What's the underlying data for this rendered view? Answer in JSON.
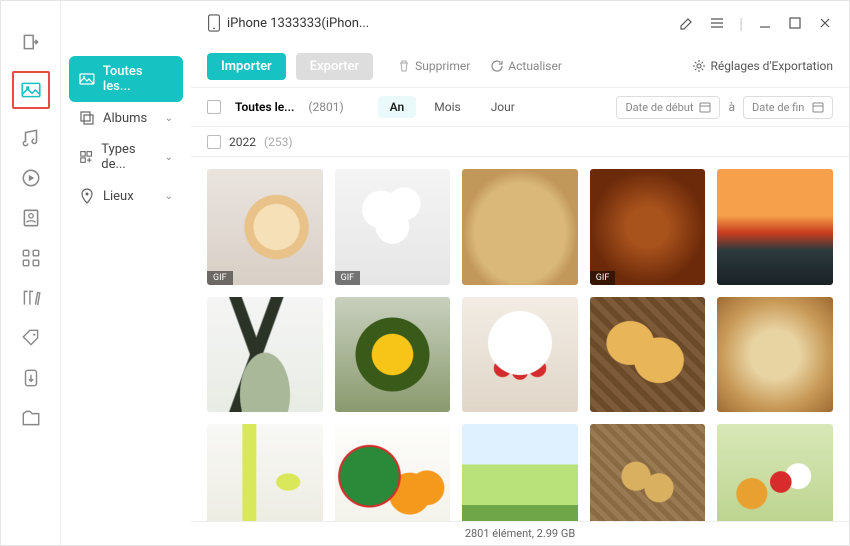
{
  "header": {
    "device_name": "iPhone 1333333(iPhon...",
    "icons": {
      "edit": "edit-icon",
      "menu": "menu-icon",
      "min": "minimize-icon",
      "max": "maximize-icon",
      "close": "close-icon"
    }
  },
  "rail": {
    "items": [
      {
        "name": "export-icon"
      },
      {
        "name": "photos-icon",
        "selected": true
      },
      {
        "name": "music-icon"
      },
      {
        "name": "video-icon"
      },
      {
        "name": "contacts-icon"
      },
      {
        "name": "apps-icon"
      },
      {
        "name": "books-icon"
      },
      {
        "name": "tags-icon"
      },
      {
        "name": "backup-icon"
      },
      {
        "name": "files-icon"
      }
    ]
  },
  "sidebar": {
    "items": [
      {
        "icon": "image-icon",
        "label": "Toutes les...",
        "primary": true
      },
      {
        "icon": "album-icon",
        "label": "Albums",
        "chev": true
      },
      {
        "icon": "types-icon",
        "label": "Types de...",
        "chev": true
      },
      {
        "icon": "location-icon",
        "label": "Lieux",
        "chev": true
      }
    ]
  },
  "toolbar": {
    "import_label": "Importer",
    "export_label": "Exporter",
    "delete_label": "Supprimer",
    "refresh_label": "Actualiser",
    "settings_label": "Réglages d'Exportation"
  },
  "filter": {
    "select_all_label": "Toutes le...",
    "total_count": "(2801)",
    "seg": [
      {
        "label": "An",
        "active": true
      },
      {
        "label": "Mois",
        "active": false
      },
      {
        "label": "Jour",
        "active": false
      }
    ],
    "start_placeholder": "Date de début",
    "to_label": "à",
    "end_placeholder": "Date de fin"
  },
  "yearbar": {
    "year": "2022",
    "count": "(253)"
  },
  "thumbs": [
    {
      "cls": "t1",
      "badge": "GIF"
    },
    {
      "cls": "t2",
      "badge": "GIF"
    },
    {
      "cls": "t3"
    },
    {
      "cls": "t4",
      "badge": "GIF"
    },
    {
      "cls": "t5"
    },
    {
      "cls": "t6"
    },
    {
      "cls": "t7"
    },
    {
      "cls": "t8"
    },
    {
      "cls": "t9"
    },
    {
      "cls": "t10"
    },
    {
      "cls": "t11"
    },
    {
      "cls": "t12"
    },
    {
      "cls": "t13"
    },
    {
      "cls": "t14"
    },
    {
      "cls": "t15"
    }
  ],
  "footer": {
    "status": "2801 élément, 2.99 GB"
  }
}
